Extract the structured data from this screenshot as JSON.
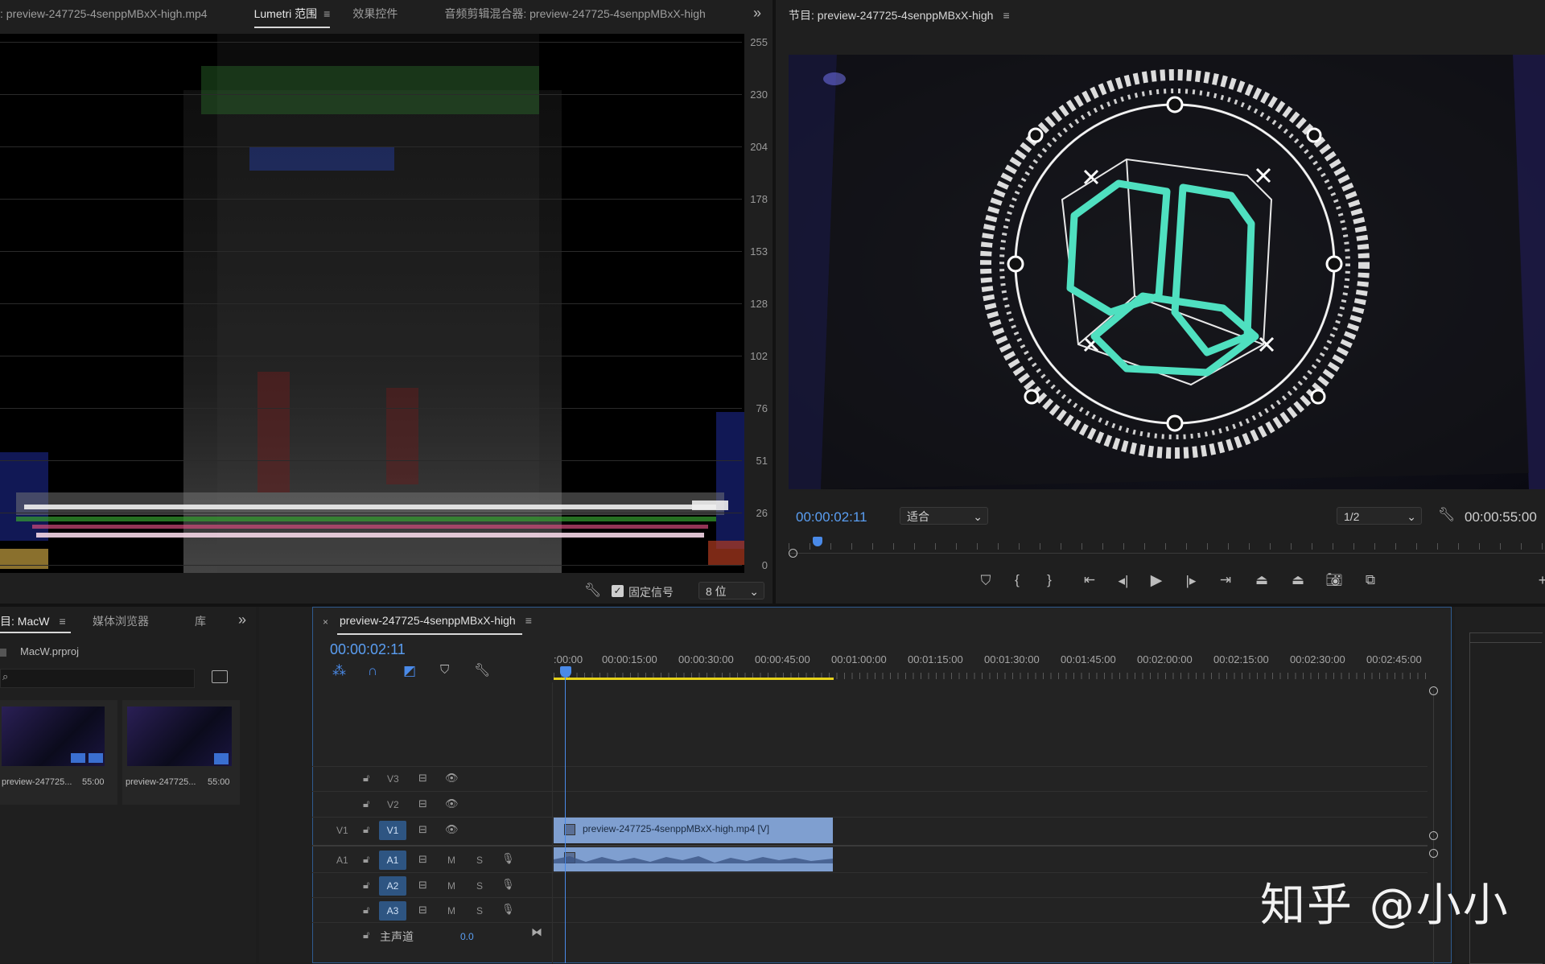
{
  "scopes_panel": {
    "tabs": [
      {
        "label": ": preview-247725-4senppMBxX-high.mp4"
      },
      {
        "label": "Lumetri 范围"
      },
      {
        "label": "效果控件"
      },
      {
        "label": "音频剪辑混合器: preview-247725-4senppMBxX-high"
      }
    ],
    "overflow_icon": "double-chevron-right-icon",
    "scale_labels": [
      "255",
      "230",
      "204",
      "178",
      "153",
      "128",
      "102",
      "76",
      "51",
      "26",
      "0"
    ],
    "clamp_label": "固定信号",
    "clamp_checked": true,
    "bit_depth": "8 位"
  },
  "program_monitor": {
    "title": "节目: preview-247725-4senppMBxX-high",
    "current_time": "00:00:02:11",
    "fit": "适合",
    "resolution": "1/2",
    "duration": "00:00:55:00",
    "transport_icons": [
      "marker-icon",
      "mark-in-icon",
      "mark-out-icon",
      "go-to-in-icon",
      "step-back-icon",
      "play-icon",
      "step-forward-icon",
      "go-to-out-icon",
      "lift-icon",
      "extract-icon",
      "camera-icon",
      "compare-icon"
    ]
  },
  "project_panel": {
    "tabs": [
      {
        "label": "目: MacW"
      },
      {
        "label": "媒体浏览器"
      },
      {
        "label": "库"
      }
    ],
    "project_file": "MacW.prproj",
    "items": [
      {
        "name": "preview-247725...",
        "duration": "55:00"
      },
      {
        "name": "preview-247725...",
        "duration": "55:00"
      }
    ]
  },
  "timeline": {
    "sequence_name": "preview-247725-4senppMBxX-high",
    "timecode": "00:00:02:11",
    "ruler": [
      ":00:00",
      "00:00:15:00",
      "00:00:30:00",
      "00:00:45:00",
      "00:01:00:00",
      "00:01:15:00",
      "00:01:30:00",
      "00:01:45:00",
      "00:02:00:00",
      "00:02:15:00",
      "00:02:30:00",
      "00:02:45:00"
    ],
    "tracks": [
      {
        "source": "",
        "name": "V3",
        "targeted": false,
        "type": "video"
      },
      {
        "source": "",
        "name": "V2",
        "targeted": false,
        "type": "video"
      },
      {
        "source": "V1",
        "name": "V1",
        "targeted": true,
        "type": "video"
      },
      {
        "source": "A1",
        "name": "A1",
        "targeted": true,
        "type": "audio"
      },
      {
        "source": "",
        "name": "A2",
        "targeted": true,
        "type": "audio"
      },
      {
        "source": "",
        "name": "A3",
        "targeted": true,
        "type": "audio"
      }
    ],
    "mute_label": "M",
    "solo_label": "S",
    "master_label": "主声道",
    "master_value": "0.0",
    "video_clip_label": "preview-247725-4senppMBxX-high.mp4 [V]"
  },
  "watermark": "知乎 @小小",
  "colors": {
    "accent_blue": "#5a9ef2",
    "clip_blue": "#7f9fd0",
    "track_button_blue": "#2e5582",
    "playhead_blue": "#4a8ae8",
    "workarea_yellow": "#e6d21a",
    "hud_cyan": "#4fe0c0"
  }
}
